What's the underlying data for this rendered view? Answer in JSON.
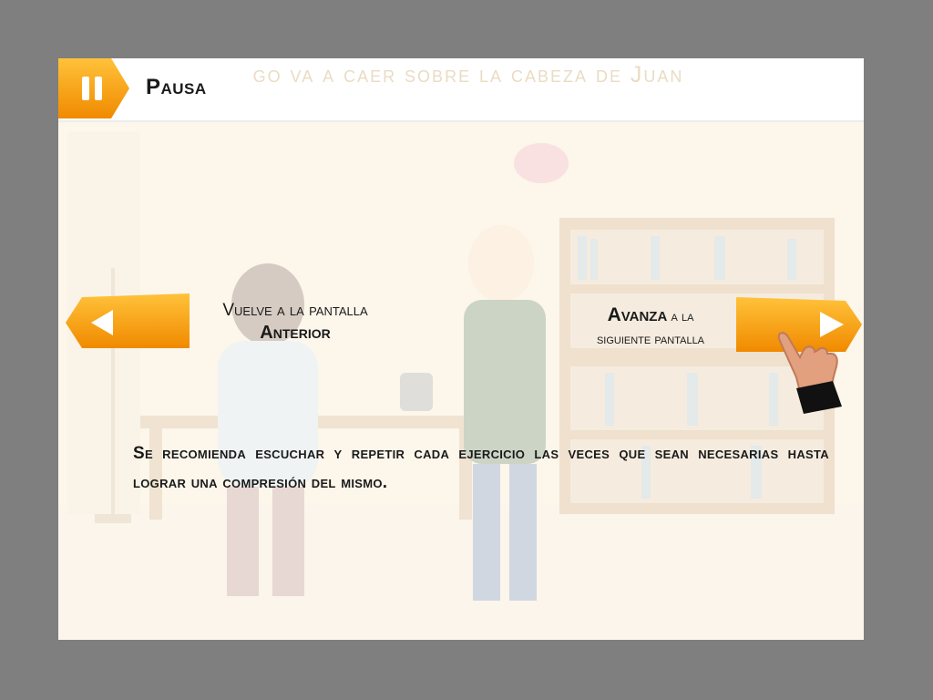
{
  "header": {
    "pause_label": "Pausa",
    "background_title": "go va a caer sobre la cabeza de Juan"
  },
  "navigation": {
    "prev": {
      "line1": "Vuelve  a la pantalla",
      "line2": "Anterior"
    },
    "next": {
      "bold": "Avanza",
      "line1_rest": " a la",
      "line2": "siguiente pantalla"
    }
  },
  "instruction": "Se recomienda escuchar y repetir cada ejercicio las veces que sean necesarias hasta lograr una compresión del mismo.",
  "icons": [
    "pause-icon",
    "left-arrow-icon",
    "right-arrow-icon",
    "pointing-hand-icon"
  ],
  "colors": {
    "accent": "#f7a21b",
    "accent_dark": "#e58a00",
    "page_bg": "#7f7f7f",
    "text": "#1a1a1a"
  }
}
